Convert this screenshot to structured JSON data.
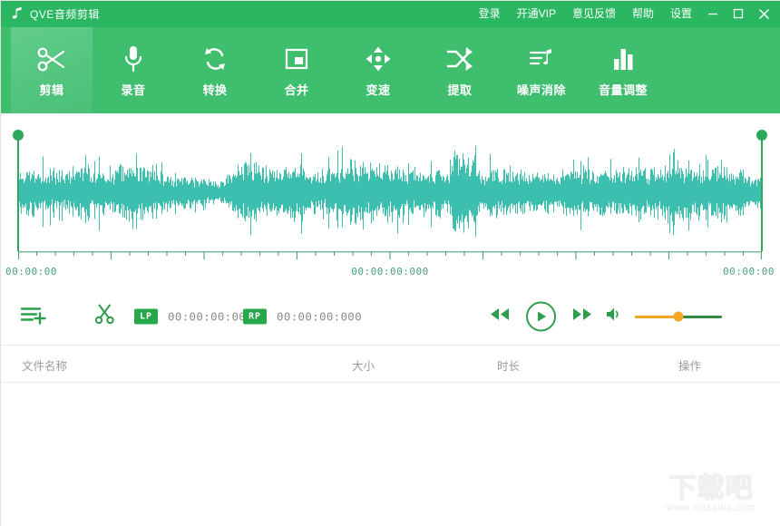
{
  "window": {
    "title": "QVE音频剪辑",
    "logo_icon": "music-note-icon",
    "menu": [
      {
        "label": "登录",
        "name": "login"
      },
      {
        "label": "开通VIP",
        "name": "open-vip"
      },
      {
        "label": "意见反馈",
        "name": "feedback"
      },
      {
        "label": "帮助",
        "name": "help"
      },
      {
        "label": "设置",
        "name": "settings"
      }
    ],
    "controls": {
      "minimize": "minimize-icon",
      "maximize": "maximize-icon",
      "close": "close-icon"
    },
    "colors": {
      "titlebar": "#2BB761",
      "toolbar": "#3FBE6E",
      "active_tab": "#53C57F",
      "waveform": "#3CBFAE",
      "marker": "#2FA85C",
      "badge": "#27A74A",
      "slider_filled": "#F5A623",
      "slider_rest": "#2E8B40"
    }
  },
  "toolbar": {
    "tabs": [
      {
        "label": "剪辑",
        "icon": "scissors-icon",
        "active": true
      },
      {
        "label": "录音",
        "icon": "microphone-icon",
        "active": false
      },
      {
        "label": "转换",
        "icon": "convert-refresh-icon",
        "active": false
      },
      {
        "label": "合并",
        "icon": "merge-square-icon",
        "active": false
      },
      {
        "label": "变速",
        "icon": "speed-arrows-icon",
        "active": false
      },
      {
        "label": "提取",
        "icon": "shuffle-extract-icon",
        "active": false
      },
      {
        "label": "噪声消除",
        "icon": "noise-note-icon",
        "active": false
      },
      {
        "label": "音量调整",
        "icon": "volume-bars-icon",
        "active": false
      }
    ]
  },
  "waveform": {
    "time_start": "00:00:00",
    "time_center": "00:00:00:000",
    "time_end": "00:00:00",
    "left_handle": "selection-start-handle",
    "right_handle": "selection-end-handle"
  },
  "controls": {
    "add_file_icon": "add-file-icon",
    "cut_icon": "scissors-cut-icon",
    "lp_badge": "LP",
    "lp_time": "00:00:00:000",
    "rp_badge": "RP",
    "rp_time": "00:00:00:000",
    "rewind_icon": "rewind-icon",
    "play_icon": "play-icon",
    "forward_icon": "forward-icon",
    "volume_icon": "volume-icon",
    "volume_percent": 50
  },
  "file_list": {
    "columns": [
      {
        "label": "文件名称",
        "name": "file-name"
      },
      {
        "label": "大小",
        "name": "file-size"
      },
      {
        "label": "时长",
        "name": "file-duration"
      },
      {
        "label": "操作",
        "name": "file-actions"
      }
    ],
    "rows": []
  },
  "watermark": {
    "text": "下载吧",
    "url": "www.xiazaiba.com"
  }
}
